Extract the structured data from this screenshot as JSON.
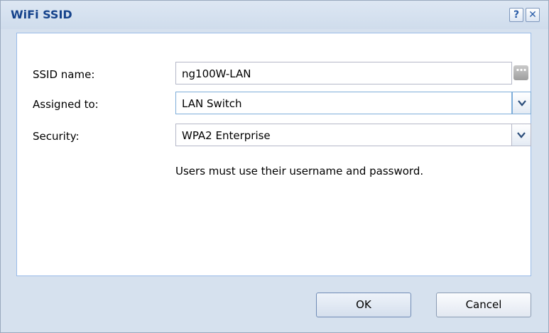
{
  "dialog": {
    "title": "WiFi SSID",
    "help_glyph": "?",
    "close_glyph": "✕"
  },
  "form": {
    "ssid_label": "SSID name:",
    "ssid_value": "ng100W-LAN",
    "ssid_button_glyph": "···",
    "assigned_label": "Assigned to:",
    "assigned_value": "LAN Switch",
    "security_label": "Security:",
    "security_value": "WPA2 Enterprise",
    "security_hint": "Users must use their username and password."
  },
  "buttons": {
    "ok": "OK",
    "cancel": "Cancel"
  },
  "icons": {
    "help": "help-icon",
    "close": "close-icon",
    "more": "ellipsis-icon",
    "dropdown": "chevron-down-icon"
  },
  "colors": {
    "title_text": "#15428b",
    "dialog_bg": "#d6e1ee",
    "panel_border": "#99bbe8"
  }
}
